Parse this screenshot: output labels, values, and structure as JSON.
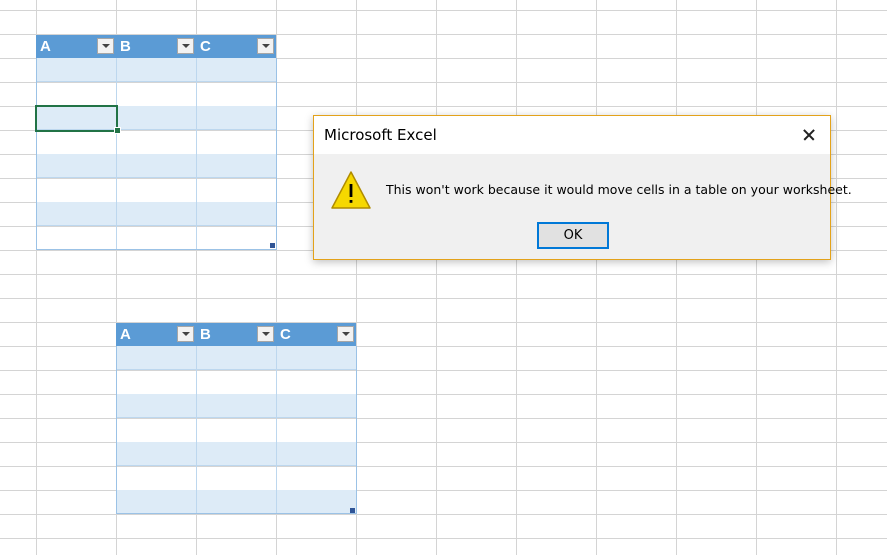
{
  "table1": {
    "headers": [
      "A",
      "B",
      "C"
    ]
  },
  "table2": {
    "headers": [
      "A",
      "B",
      "C"
    ]
  },
  "dialog": {
    "title": "Microsoft Excel",
    "message": "This won't work because it would move cells in a table on your worksheet.",
    "ok_label": "OK",
    "icon": "warning-icon",
    "border_color": "#e3a21a"
  },
  "colors": {
    "table_header": "#5b9bd5",
    "table_band": "#ddebf7",
    "selection": "#217346",
    "button_focus": "#0078d7"
  }
}
